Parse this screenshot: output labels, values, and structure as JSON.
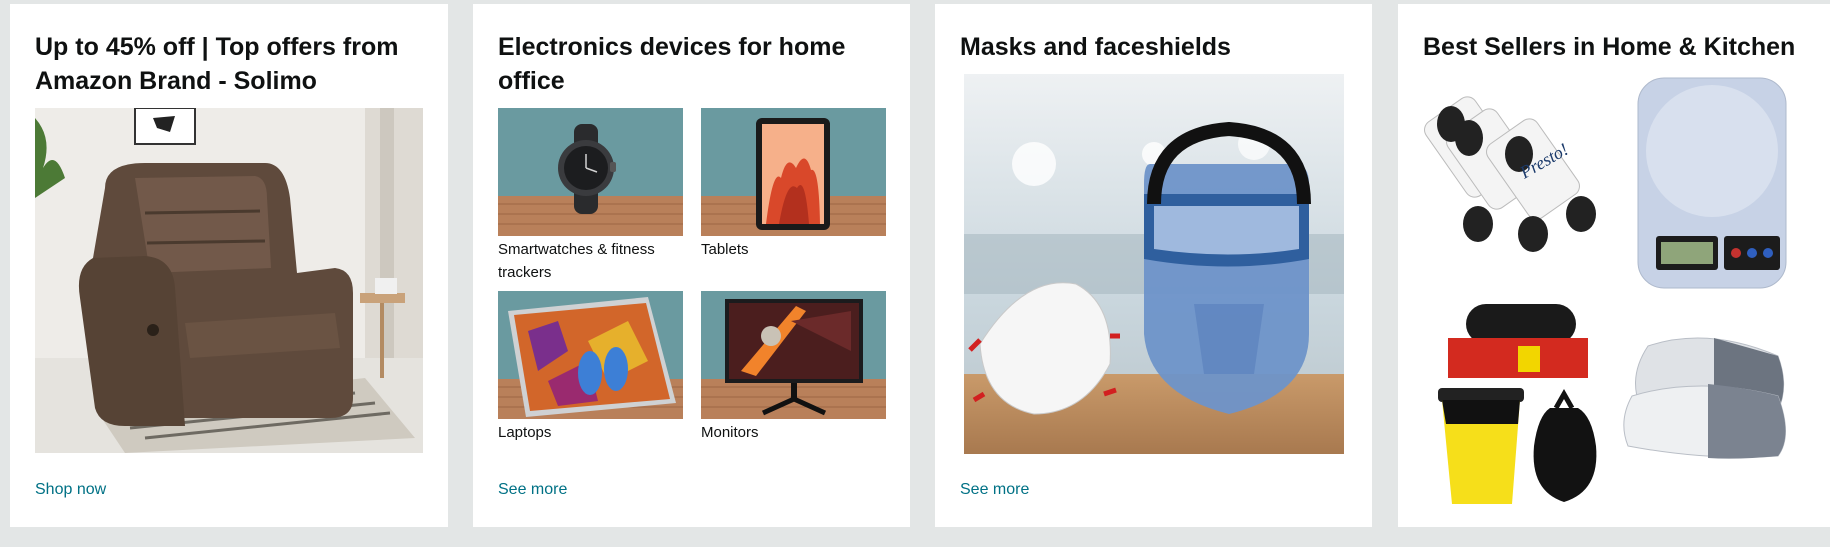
{
  "cards": [
    {
      "title": "Up to 45% off | Top offers from Amazon Brand - Solimo",
      "link": "Shop now",
      "image": "recliner-chair-photo"
    },
    {
      "title": "Electronics devices for home office",
      "link": "See more",
      "items": [
        {
          "label": "Smartwatches & fitness trackers",
          "icon": "smartwatch-image"
        },
        {
          "label": "Tablets",
          "icon": "tablet-image"
        },
        {
          "label": "Laptops",
          "icon": "laptop-image"
        },
        {
          "label": "Monitors",
          "icon": "monitor-image"
        }
      ]
    },
    {
      "title": "Masks and faceshields",
      "link": "See more",
      "image": "mask-faceshield-photo"
    },
    {
      "title": "Best Sellers in Home & Kitchen",
      "items": [
        {
          "icon": "garbage-bag-rolls-image",
          "brand_text": "Presto!"
        },
        {
          "icon": "kitchen-scale-image"
        },
        {
          "icon": "dustbin-and-bags-image"
        },
        {
          "icon": "pillows-image"
        }
      ]
    }
  ],
  "colors": {
    "page_bg": "#e3e6e6",
    "card_bg": "#ffffff",
    "link": "#007185",
    "title": "#0f1111",
    "thumb_teal": "#6a9aa0",
    "floor_wood": "#b9805a"
  }
}
